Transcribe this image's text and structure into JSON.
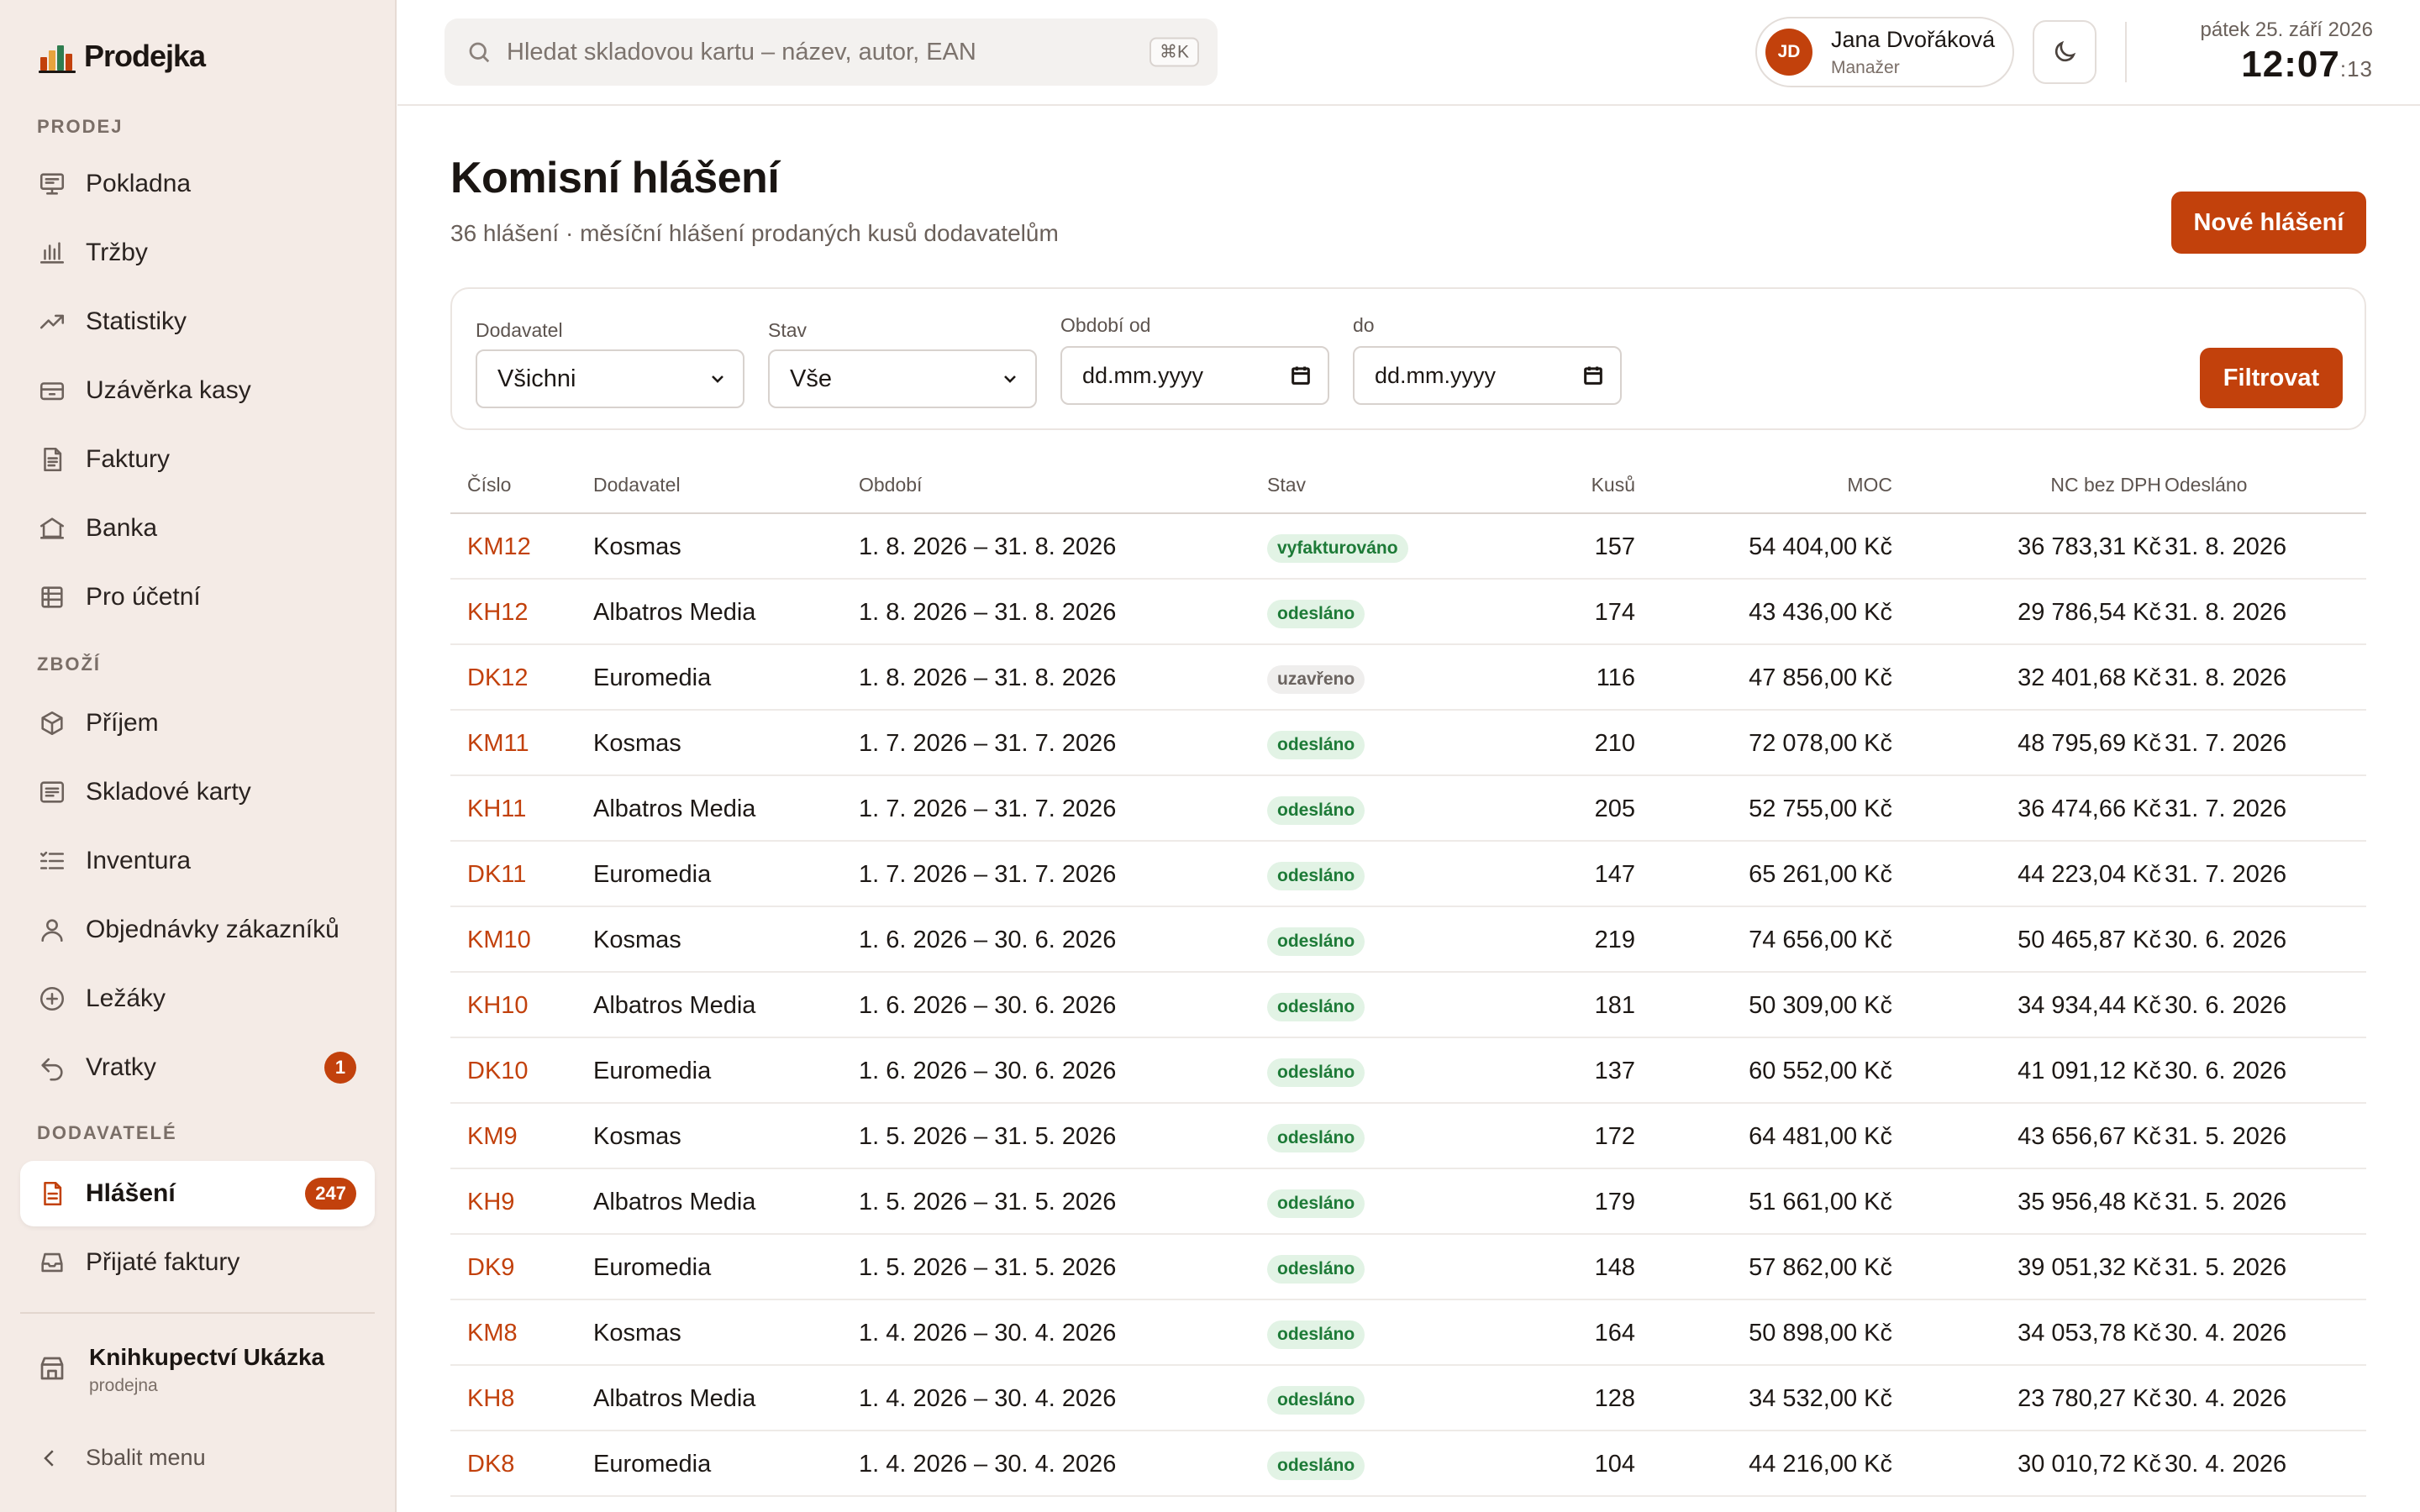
{
  "app": {
    "name": "Prodejka"
  },
  "sidebar": {
    "sections": [
      {
        "label": "PRODEJ",
        "items": [
          {
            "label": "Pokladna",
            "icon": "cash-register-icon"
          },
          {
            "label": "Tržby",
            "icon": "bar-chart-icon"
          },
          {
            "label": "Statistiky",
            "icon": "trend-line-icon"
          },
          {
            "label": "Uzávěrka kasy",
            "icon": "cash-drawer-icon"
          },
          {
            "label": "Faktury",
            "icon": "document-icon"
          },
          {
            "label": "Banka",
            "icon": "bank-icon"
          },
          {
            "label": "Pro účetní",
            "icon": "spreadsheet-icon"
          }
        ]
      },
      {
        "label": "ZBOŽÍ",
        "items": [
          {
            "label": "Příjem",
            "icon": "box-icon"
          },
          {
            "label": "Skladové karty",
            "icon": "list-card-icon"
          },
          {
            "label": "Inventura",
            "icon": "checklist-icon"
          },
          {
            "label": "Objednávky zákazníků",
            "icon": "user-icon"
          },
          {
            "label": "Ležáky",
            "icon": "plus-circle-icon"
          },
          {
            "label": "Vratky",
            "icon": "undo-icon",
            "badge": "1"
          }
        ]
      },
      {
        "label": "DODAVATELÉ",
        "items": [
          {
            "label": "Hlášení",
            "icon": "report-icon",
            "badge": "247",
            "active": true
          },
          {
            "label": "Přijaté faktury",
            "icon": "inbox-icon"
          }
        ]
      }
    ],
    "shop": {
      "name": "Knihkupectví Ukázka",
      "type": "prodejna"
    },
    "collapse_label": "Sbalit menu"
  },
  "topbar": {
    "search": {
      "placeholder": "Hledat skladovou kartu – název, autor, EAN",
      "shortcut": "⌘K"
    },
    "user": {
      "initials": "JD",
      "name": "Jana Dvořáková",
      "role": "Manažer"
    },
    "clock": {
      "date": "pátek 25. září 2026",
      "time": "12:07",
      "seconds": ":13"
    }
  },
  "page": {
    "title": "Komisní hlášení",
    "subtitle": "36 hlášení · měsíční hlášení prodaných kusů dodavatelům",
    "new_button": "Nové hlášení"
  },
  "filters": {
    "supplier": {
      "label": "Dodavatel",
      "value": "Všichni"
    },
    "status": {
      "label": "Stav",
      "value": "Vše"
    },
    "date_from": {
      "label": "Období od",
      "placeholder": "dd.mm.yyyy"
    },
    "date_to": {
      "label": "do",
      "placeholder": "dd.mm.yyyy"
    },
    "submit": "Filtrovat"
  },
  "table": {
    "columns": [
      "Číslo",
      "Dodavatel",
      "Období",
      "Stav",
      "Kusů",
      "MOC",
      "NC bez DPH",
      "Odesláno"
    ],
    "rows": [
      {
        "id": "KM12",
        "supplier": "Kosmas",
        "period": "1. 8. 2026 – 31. 8. 2026",
        "status": "vyfakturováno",
        "qty": "157",
        "moc": "54 404,00 Kč",
        "nc": "36 783,31 Kč",
        "sent": "31. 8. 2026"
      },
      {
        "id": "KH12",
        "supplier": "Albatros Media",
        "period": "1. 8. 2026 – 31. 8. 2026",
        "status": "odesláno",
        "qty": "174",
        "moc": "43 436,00 Kč",
        "nc": "29 786,54 Kč",
        "sent": "31. 8. 2026"
      },
      {
        "id": "DK12",
        "supplier": "Euromedia",
        "period": "1. 8. 2026 – 31. 8. 2026",
        "status": "uzavřeno",
        "qty": "116",
        "moc": "47 856,00 Kč",
        "nc": "32 401,68 Kč",
        "sent": "31. 8. 2026"
      },
      {
        "id": "KM11",
        "supplier": "Kosmas",
        "period": "1. 7. 2026 – 31. 7. 2026",
        "status": "odesláno",
        "qty": "210",
        "moc": "72 078,00 Kč",
        "nc": "48 795,69 Kč",
        "sent": "31. 7. 2026"
      },
      {
        "id": "KH11",
        "supplier": "Albatros Media",
        "period": "1. 7. 2026 – 31. 7. 2026",
        "status": "odesláno",
        "qty": "205",
        "moc": "52 755,00 Kč",
        "nc": "36 474,66 Kč",
        "sent": "31. 7. 2026"
      },
      {
        "id": "DK11",
        "supplier": "Euromedia",
        "period": "1. 7. 2026 – 31. 7. 2026",
        "status": "odesláno",
        "qty": "147",
        "moc": "65 261,00 Kč",
        "nc": "44 223,04 Kč",
        "sent": "31. 7. 2026"
      },
      {
        "id": "KM10",
        "supplier": "Kosmas",
        "period": "1. 6. 2026 – 30. 6. 2026",
        "status": "odesláno",
        "qty": "219",
        "moc": "74 656,00 Kč",
        "nc": "50 465,87 Kč",
        "sent": "30. 6. 2026"
      },
      {
        "id": "KH10",
        "supplier": "Albatros Media",
        "period": "1. 6. 2026 – 30. 6. 2026",
        "status": "odesláno",
        "qty": "181",
        "moc": "50 309,00 Kč",
        "nc": "34 934,44 Kč",
        "sent": "30. 6. 2026"
      },
      {
        "id": "DK10",
        "supplier": "Euromedia",
        "period": "1. 6. 2026 – 30. 6. 2026",
        "status": "odesláno",
        "qty": "137",
        "moc": "60 552,00 Kč",
        "nc": "41 091,12 Kč",
        "sent": "30. 6. 2026"
      },
      {
        "id": "KM9",
        "supplier": "Kosmas",
        "period": "1. 5. 2026 – 31. 5. 2026",
        "status": "odesláno",
        "qty": "172",
        "moc": "64 481,00 Kč",
        "nc": "43 656,67 Kč",
        "sent": "31. 5. 2026"
      },
      {
        "id": "KH9",
        "supplier": "Albatros Media",
        "period": "1. 5. 2026 – 31. 5. 2026",
        "status": "odesláno",
        "qty": "179",
        "moc": "51 661,00 Kč",
        "nc": "35 956,48 Kč",
        "sent": "31. 5. 2026"
      },
      {
        "id": "DK9",
        "supplier": "Euromedia",
        "period": "1. 5. 2026 – 31. 5. 2026",
        "status": "odesláno",
        "qty": "148",
        "moc": "57 862,00 Kč",
        "nc": "39 051,32 Kč",
        "sent": "31. 5. 2026"
      },
      {
        "id": "KM8",
        "supplier": "Kosmas",
        "period": "1. 4. 2026 – 30. 4. 2026",
        "status": "odesláno",
        "qty": "164",
        "moc": "50 898,00 Kč",
        "nc": "34 053,78 Kč",
        "sent": "30. 4. 2026"
      },
      {
        "id": "KH8",
        "supplier": "Albatros Media",
        "period": "1. 4. 2026 – 30. 4. 2026",
        "status": "odesláno",
        "qty": "128",
        "moc": "34 532,00 Kč",
        "nc": "23 780,27 Kč",
        "sent": "30. 4. 2026"
      },
      {
        "id": "DK8",
        "supplier": "Euromedia",
        "period": "1. 4. 2026 – 30. 4. 2026",
        "status": "odesláno",
        "qty": "104",
        "moc": "44 216,00 Kč",
        "nc": "30 010,72 Kč",
        "sent": "30. 4. 2026"
      }
    ]
  },
  "colors": {
    "accent": "#c2410c",
    "sidebar_bg": "#f4ebe6",
    "success_bg": "#e2f3e5",
    "success_text": "#1d7a37"
  }
}
